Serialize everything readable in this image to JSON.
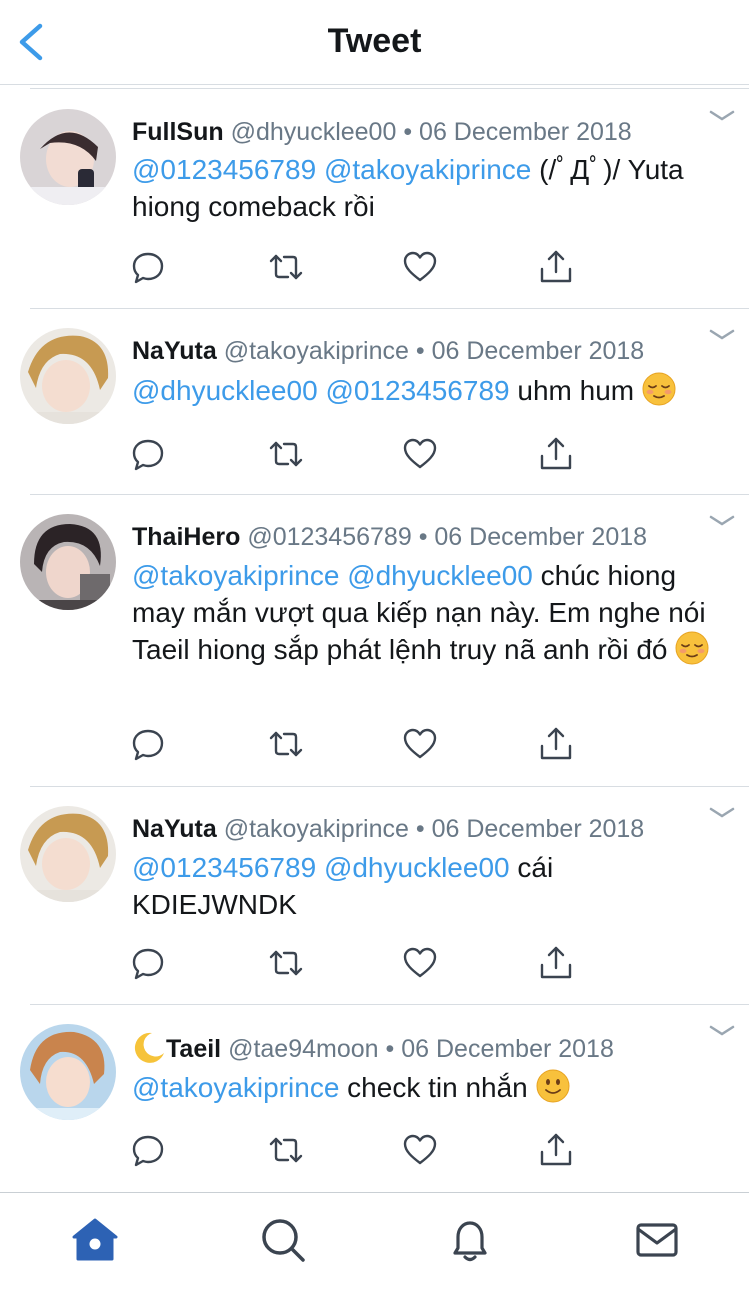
{
  "header": {
    "title": "Tweet",
    "back_icon": "chevron-left-icon"
  },
  "colors": {
    "accent": "#3d9be9",
    "text": "#14171a",
    "muted": "#697886",
    "tab_active": "#2d62b4"
  },
  "tweets": [
    {
      "name": "FullSun",
      "handle": "@dhyucklee00",
      "dot": "•",
      "date": "06 December 2018",
      "body": [
        {
          "type": "mention",
          "text": "@0123456789"
        },
        {
          "type": "text",
          "text": " "
        },
        {
          "type": "mention",
          "text": "@takoyakiprince"
        },
        {
          "type": "text",
          "text": " (/ﾟДﾟ)/ Yuta hiong comeback rồi"
        }
      ]
    },
    {
      "name": "NaYuta",
      "handle": "@takoyakiprince",
      "dot": "•",
      "date": "06 December 2018",
      "body": [
        {
          "type": "mention",
          "text": "@dhyucklee00"
        },
        {
          "type": "text",
          "text": " "
        },
        {
          "type": "mention",
          "text": "@0123456789"
        },
        {
          "type": "text",
          "text": " uhm hum "
        },
        {
          "type": "emoji",
          "name": "relieved-face-emoji"
        }
      ]
    },
    {
      "name": "ThaiHero",
      "handle": "@0123456789",
      "dot": "•",
      "date": "06 December 2018",
      "body": [
        {
          "type": "mention",
          "text": "@takoyakiprince"
        },
        {
          "type": "text",
          "text": " "
        },
        {
          "type": "mention",
          "text": "@dhyucklee00"
        },
        {
          "type": "text",
          "text": " chúc hiong may mắn vượt qua kiếp nạn này. Em nghe nói Taeil hiong sắp phát lệnh truy nã anh rồi đó "
        },
        {
          "type": "emoji",
          "name": "relieved-face-emoji"
        }
      ]
    },
    {
      "name": "NaYuta",
      "handle": "@takoyakiprince",
      "dot": "•",
      "date": "06 December 2018",
      "body": [
        {
          "type": "mention",
          "text": "@0123456789"
        },
        {
          "type": "text",
          "text": " "
        },
        {
          "type": "mention",
          "text": "@dhyucklee00"
        },
        {
          "type": "text",
          "text": " cái KDIEJWNDK"
        }
      ]
    },
    {
      "name": "Taeil",
      "name_prefix_emoji": "crescent-moon-emoji",
      "handle": "@tae94moon",
      "dot": "•",
      "date": "06 December 2018",
      "body": [
        {
          "type": "mention",
          "text": "@takoyakiprince"
        },
        {
          "type": "text",
          "text": " check tin nhắn "
        },
        {
          "type": "emoji",
          "name": "slightly-smiling-face-emoji"
        }
      ]
    }
  ],
  "tabs": [
    {
      "name": "home",
      "icon": "home-icon",
      "active": true
    },
    {
      "name": "search",
      "icon": "search-icon",
      "active": false
    },
    {
      "name": "notifications",
      "icon": "bell-icon",
      "active": false
    },
    {
      "name": "messages",
      "icon": "envelope-icon",
      "active": false
    }
  ]
}
